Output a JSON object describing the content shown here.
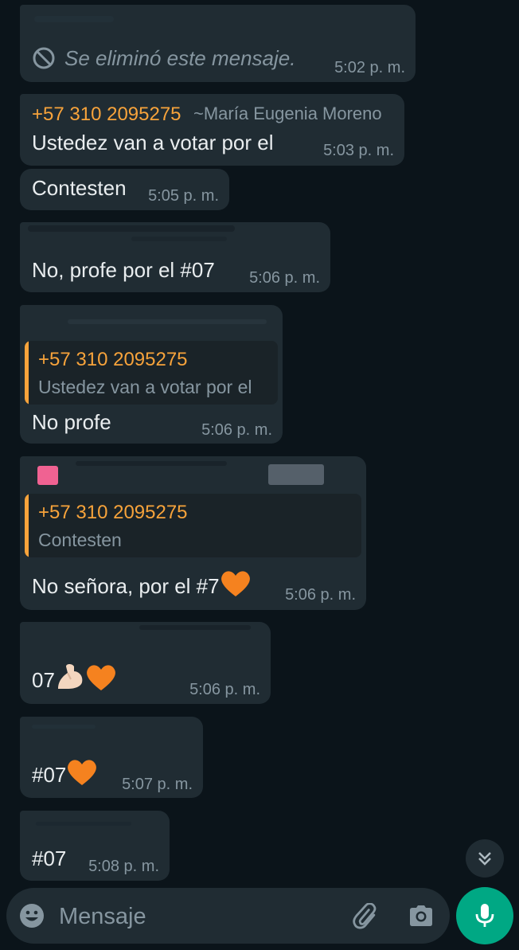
{
  "messages": [
    {
      "kind": "deleted",
      "text": "Se eliminó este mensaje.",
      "time": "5:02 p. m."
    },
    {
      "kind": "text",
      "sender_phone": "+57 310 2095275",
      "sender_name": "~María Eugenia Moreno",
      "text": "Ustedez van a votar por el",
      "time": "5:03 p. m."
    },
    {
      "kind": "text",
      "text": "Contesten",
      "time": "5:05 p. m."
    },
    {
      "kind": "text",
      "text": "No, profe por el #07",
      "time": "5:06 p. m."
    },
    {
      "kind": "reply",
      "quote_name": "+57 310 2095275",
      "quote_text": "Ustedez van a votar por el",
      "text": "No profe",
      "time": "5:06 p. m."
    },
    {
      "kind": "reply",
      "quote_name": "+57 310 2095275",
      "quote_text": "Contesten",
      "text": "No señora, por el #7",
      "time": "5:06 p. m."
    },
    {
      "kind": "text",
      "text": "07",
      "time": "5:06 p. m."
    },
    {
      "kind": "text",
      "text": "#07",
      "time": "5:07 p. m."
    },
    {
      "kind": "text",
      "text": "#07",
      "time": "5:08 p. m."
    }
  ],
  "composer": {
    "placeholder": "Mensaje"
  },
  "icons": {
    "deleted": "block-icon",
    "scroll": "double-chevron-down-icon",
    "emoji": "emoji-icon",
    "attach": "paperclip-icon",
    "camera": "camera-icon",
    "mic": "microphone-icon",
    "heart": "orange-heart-icon",
    "muscle": "flexed-biceps-icon"
  },
  "colors": {
    "background": "#0b141a",
    "bubble": "#202c33",
    "accent": "#00a884",
    "sender": "#f7a33b",
    "meta": "#8696a0"
  }
}
